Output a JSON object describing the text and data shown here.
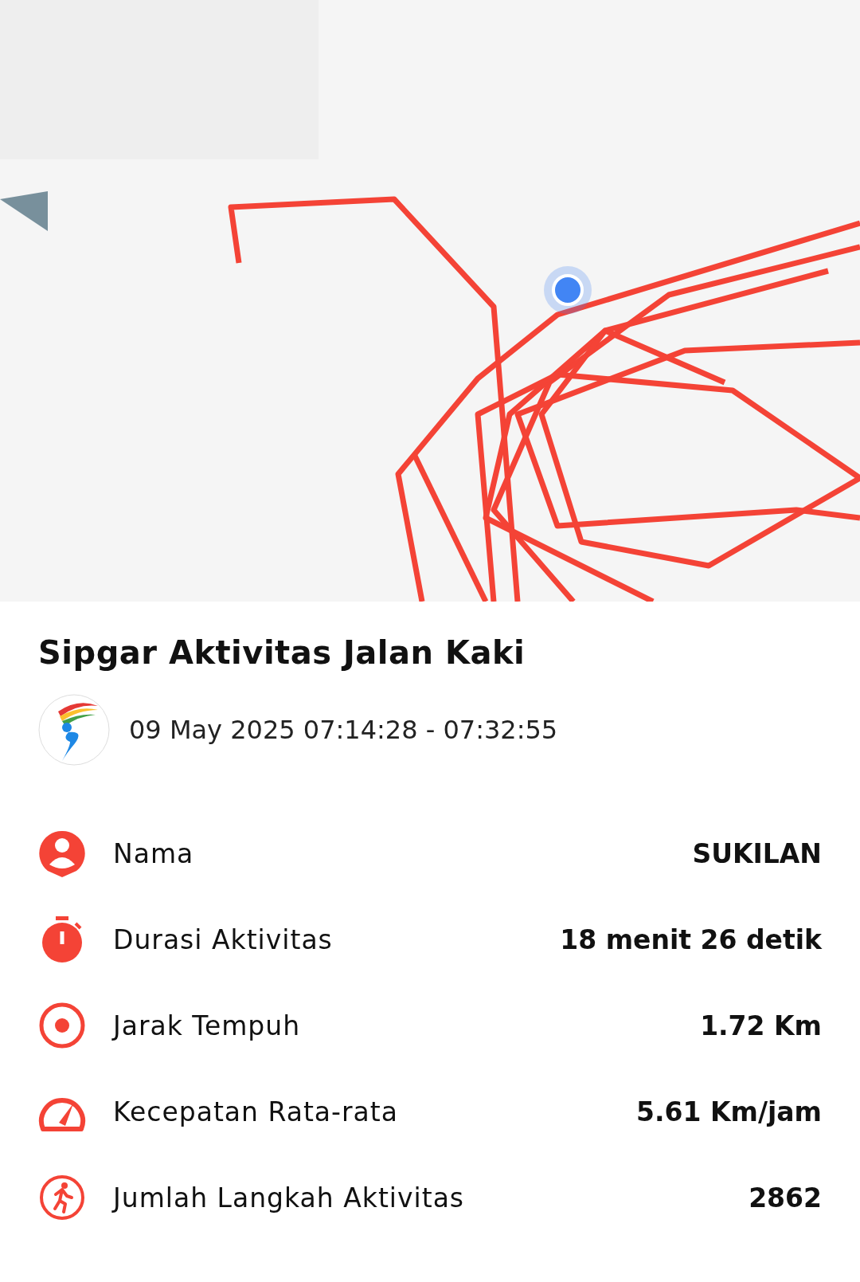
{
  "title": "Sipgar Aktivitas Jalan Kaki",
  "date_range": "09 May 2025 07:14:28 - 07:32:55",
  "stats": [
    {
      "kind": "person",
      "label": "Nama",
      "value": "SUKILAN"
    },
    {
      "kind": "timer",
      "label": "Durasi Aktivitas",
      "value": "18 menit 26 detik"
    },
    {
      "kind": "target",
      "label": "Jarak Tempuh",
      "value": "1.72 Km"
    },
    {
      "kind": "speed",
      "label": "Kecepatan Rata-rata",
      "value": "5.61 Km/jam"
    },
    {
      "kind": "steps",
      "label": "Jumlah Langkah Aktivitas",
      "value": "2862"
    }
  ]
}
